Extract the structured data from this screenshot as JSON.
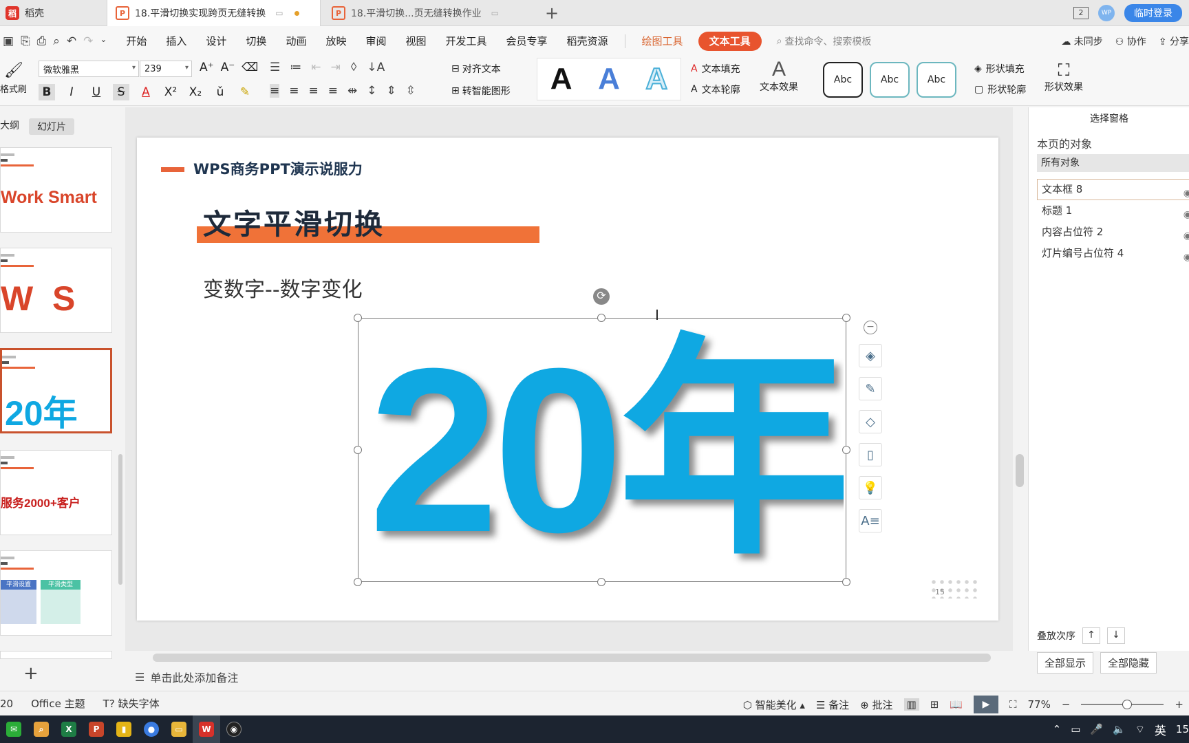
{
  "tabs": {
    "home": "稻壳",
    "active": "18.平滑切换实现跨页无缝转换",
    "second": "18.平滑切换...页无缝转换作业"
  },
  "titlebar": {
    "window_count": "2",
    "avatar": "WP",
    "login": "临时登录"
  },
  "menu": {
    "items": [
      "开始",
      "插入",
      "设计",
      "切换",
      "动画",
      "放映",
      "审阅",
      "视图",
      "开发工具",
      "会员专享",
      "稻壳资源"
    ],
    "draw_tool": "绘图工具",
    "text_tool": "文本工具",
    "search_placeholder": "查找命令、搜索模板",
    "sync": "未同步",
    "collab": "协作",
    "share": "分享"
  },
  "ribbon": {
    "format_painter": "格式刷",
    "font_name": "微软雅黑",
    "font_size": "239",
    "align_text": "对齐文本",
    "smart_graphic": "转智能图形",
    "text_fill": "文本填充",
    "text_outline": "文本轮廓",
    "text_effect": "文本效果",
    "abc": [
      "Abc",
      "Abc",
      "Abc"
    ],
    "shape_fill": "形状填充",
    "shape_outline": "形状轮廓",
    "shape_effect": "形状效果",
    "colors": {
      "accent_orange": "#e8542e",
      "brand_blue": "#0fa8e2"
    }
  },
  "left_pane": {
    "tab_outline": "大纲",
    "tab_slides": "幻灯片",
    "thumbs": [
      "Work Smart",
      "W  S",
      "20年",
      "服务2000+客户",
      "",
      ""
    ],
    "thumb5_cards": [
      "平滑设置",
      "平滑类型"
    ]
  },
  "slide": {
    "brand": "WPS商务PPT演示说服力",
    "title": "文字平滑切换",
    "subtitle": "变数字--数字变化",
    "big_text": "20年",
    "page_number": "15"
  },
  "notes_placeholder": "单击此处添加备注",
  "right_pane": {
    "title": "选择窗格",
    "subtitle": "本页的对象",
    "all_objects": "所有对象",
    "objects": [
      "文本框 8",
      "标题 1",
      "内容占位符 2",
      "灯片编号占位符 4"
    ],
    "order_label": "叠放次序",
    "show_all": "全部显示",
    "hide_all": "全部隐藏"
  },
  "status": {
    "slide_num": "20",
    "theme": "Office 主题",
    "missing_font": "缺失字体",
    "beautify": "智能美化",
    "notes": "备注",
    "comments": "批注",
    "zoom": "77%"
  },
  "taskbar": {
    "ime": "英",
    "clock": "15"
  }
}
